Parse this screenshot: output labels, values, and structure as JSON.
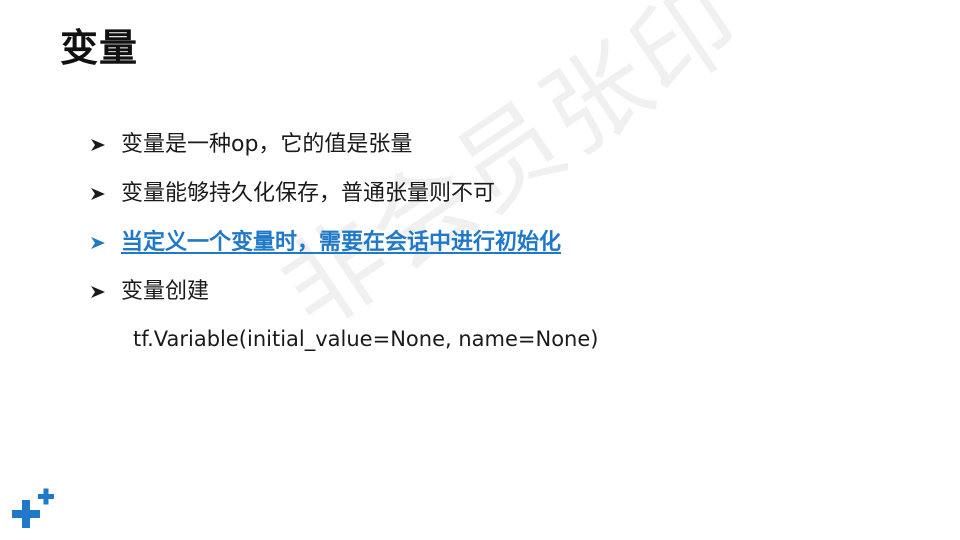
{
  "slide": {
    "title": "变量",
    "bullets": [
      {
        "text": "变量是一种op，它的值是张量",
        "highlight": false
      },
      {
        "text": "变量能够持久化保存，普通张量则不可",
        "highlight": false
      },
      {
        "text": "当定义一个变量时，需要在会话中进行初始化",
        "highlight": true
      },
      {
        "text": "变量创建",
        "highlight": false
      }
    ],
    "code": "tf.Variable(initial_value=None, name=None)",
    "watermark": "非会员张印",
    "logo_icon": "plus-logo-icon"
  },
  "colors": {
    "title": "#111111",
    "text": "#1a1a1a",
    "highlight": "#1f78c8",
    "logo": "#1f78c8",
    "watermark": "#bdbdbd"
  }
}
